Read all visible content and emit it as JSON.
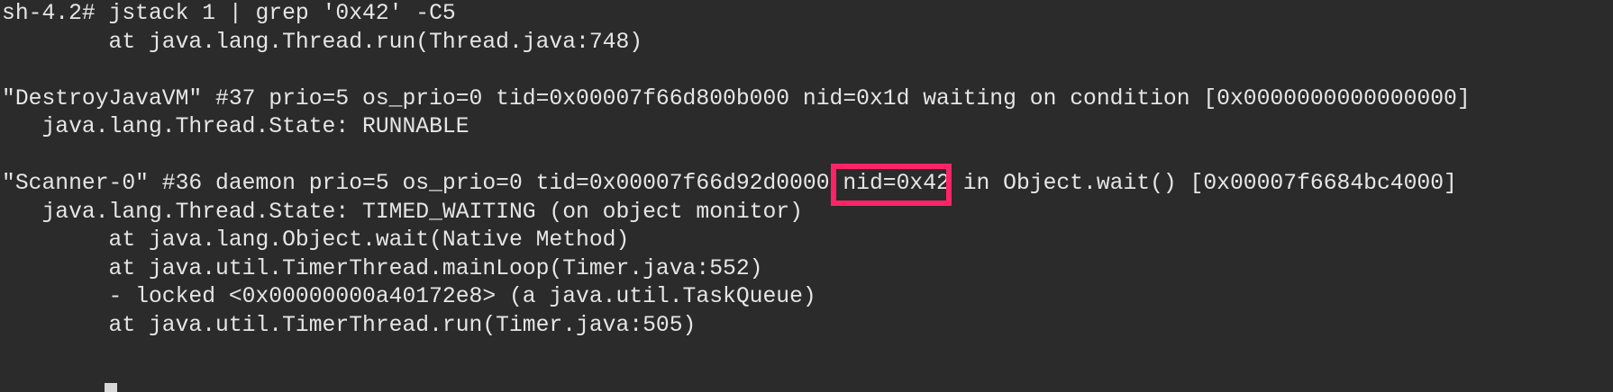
{
  "terminal": {
    "lines": [
      "sh-4.2# jstack 1 | grep '0x42' -C5",
      "        at java.lang.Thread.run(Thread.java:748)",
      "",
      "\"DestroyJavaVM\" #37 prio=5 os_prio=0 tid=0x00007f66d800b000 nid=0x1d waiting on condition [0x0000000000000000]",
      "   java.lang.Thread.State: RUNNABLE",
      "",
      "",
      "   java.lang.Thread.State: TIMED_WAITING (on object monitor)",
      "        at java.lang.Object.wait(Native Method)",
      "        at java.util.TimerThread.mainLoop(Timer.java:552)",
      "        - locked <0x00000000a40172e8> (a java.util.TaskQueue)",
      "        at java.util.TimerThread.run(Timer.java:505)"
    ],
    "highlight_line": {
      "before": "\"Scanner-0\" #36 daemon prio=5 os_prio=0 tid=0x00007f66d92d0000 ",
      "highlighted": "nid=0x42",
      "after": " in Object.wait() [0x00007f6684bc4000]"
    },
    "highlight_color": "#ff2468"
  }
}
